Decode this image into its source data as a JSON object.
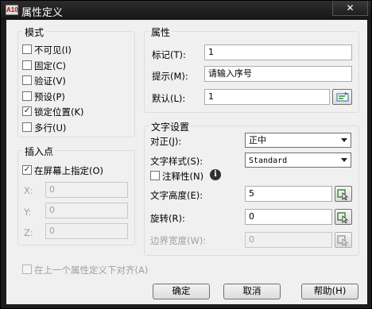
{
  "window": {
    "title": "属性定义",
    "app_icon_text": "A10",
    "close_glyph": "✕"
  },
  "mode": {
    "title": "模式",
    "items": [
      {
        "label": "不可见(I)",
        "checked": false
      },
      {
        "label": "固定(C)",
        "checked": false
      },
      {
        "label": "验证(V)",
        "checked": false
      },
      {
        "label": "预设(P)",
        "checked": false
      },
      {
        "label": "锁定位置(K)",
        "checked": true
      },
      {
        "label": "多行(U)",
        "checked": false
      }
    ]
  },
  "attribute": {
    "title": "属性",
    "tag_label": "标记(T):",
    "tag_value": "1",
    "prompt_label": "提示(M):",
    "prompt_value": "请输入序号",
    "default_label": "默认(L):",
    "default_value": "1"
  },
  "insertion": {
    "title": "插入点",
    "on_screen_label": "在屏幕上指定(O)",
    "on_screen_checked": true,
    "x_label": "X:",
    "x_value": "0",
    "y_label": "Y:",
    "y_value": "0",
    "z_label": "Z:",
    "z_value": "0"
  },
  "text_settings": {
    "title": "文字设置",
    "justify_label": "对正(J):",
    "justify_value": "正中",
    "style_label": "文字样式(S):",
    "style_value": "Standard",
    "annotative_label": "注释性(N)",
    "height_label": "文字高度(E):",
    "height_value": "5",
    "rotation_label": "旋转(R):",
    "rotation_value": "0",
    "boundary_label": "边界宽度(W):",
    "boundary_value": "0"
  },
  "align_below": {
    "label": "在上一个属性定义下对齐(A)",
    "checked": false,
    "enabled": false
  },
  "buttons": {
    "ok": "确定",
    "cancel": "取消",
    "help": "帮助(H)"
  }
}
